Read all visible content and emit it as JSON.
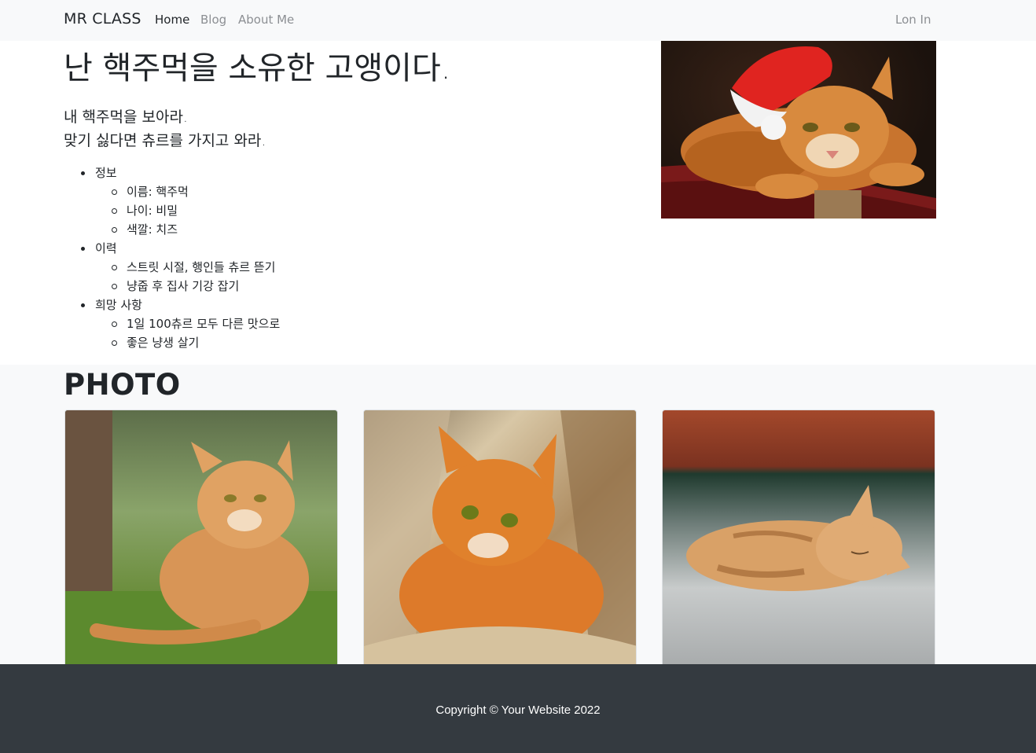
{
  "navbar": {
    "brand": "MR CLASS",
    "links": [
      {
        "label": "Home",
        "active": true
      },
      {
        "label": "Blog",
        "active": false
      },
      {
        "label": "About Me",
        "active": false
      }
    ],
    "login": "Lon In"
  },
  "hero": {
    "title": "난 핵주먹을 소유한 고앵이다.",
    "lead_lines": [
      "내 핵주먹을 보아라.",
      "맞기 싫다면 츄르를 가지고 와라."
    ],
    "sections": [
      {
        "heading": "정보",
        "items": [
          "이름: 핵주먹",
          "나이: 비밀",
          "색깔: 치즈"
        ]
      },
      {
        "heading": "이력",
        "items": [
          "스트릿 시절, 행인들 츄르 뜯기",
          "냥줍 후 집사 기강 잡기"
        ]
      },
      {
        "heading": "희망 사항",
        "items": [
          "1일 100츄르 모두 다른 맛으로",
          "좋은 냥생 살기"
        ]
      }
    ],
    "image": "cat-in-santa-hat-photo"
  },
  "photo": {
    "title": "PHOTO",
    "cards": [
      {
        "image": "sitting-orange-cat-photo"
      },
      {
        "image": "orange-cat-in-blanket-photo"
      },
      {
        "image": "sleeping-kitten-photo"
      }
    ]
  },
  "footer": {
    "copyright": "Copyright © Your Website 2022"
  },
  "colors": {
    "navbar_bg": "#f8f9fa",
    "footer_bg": "#343a40",
    "text": "#212529",
    "muted_link": "#8c8f93"
  }
}
